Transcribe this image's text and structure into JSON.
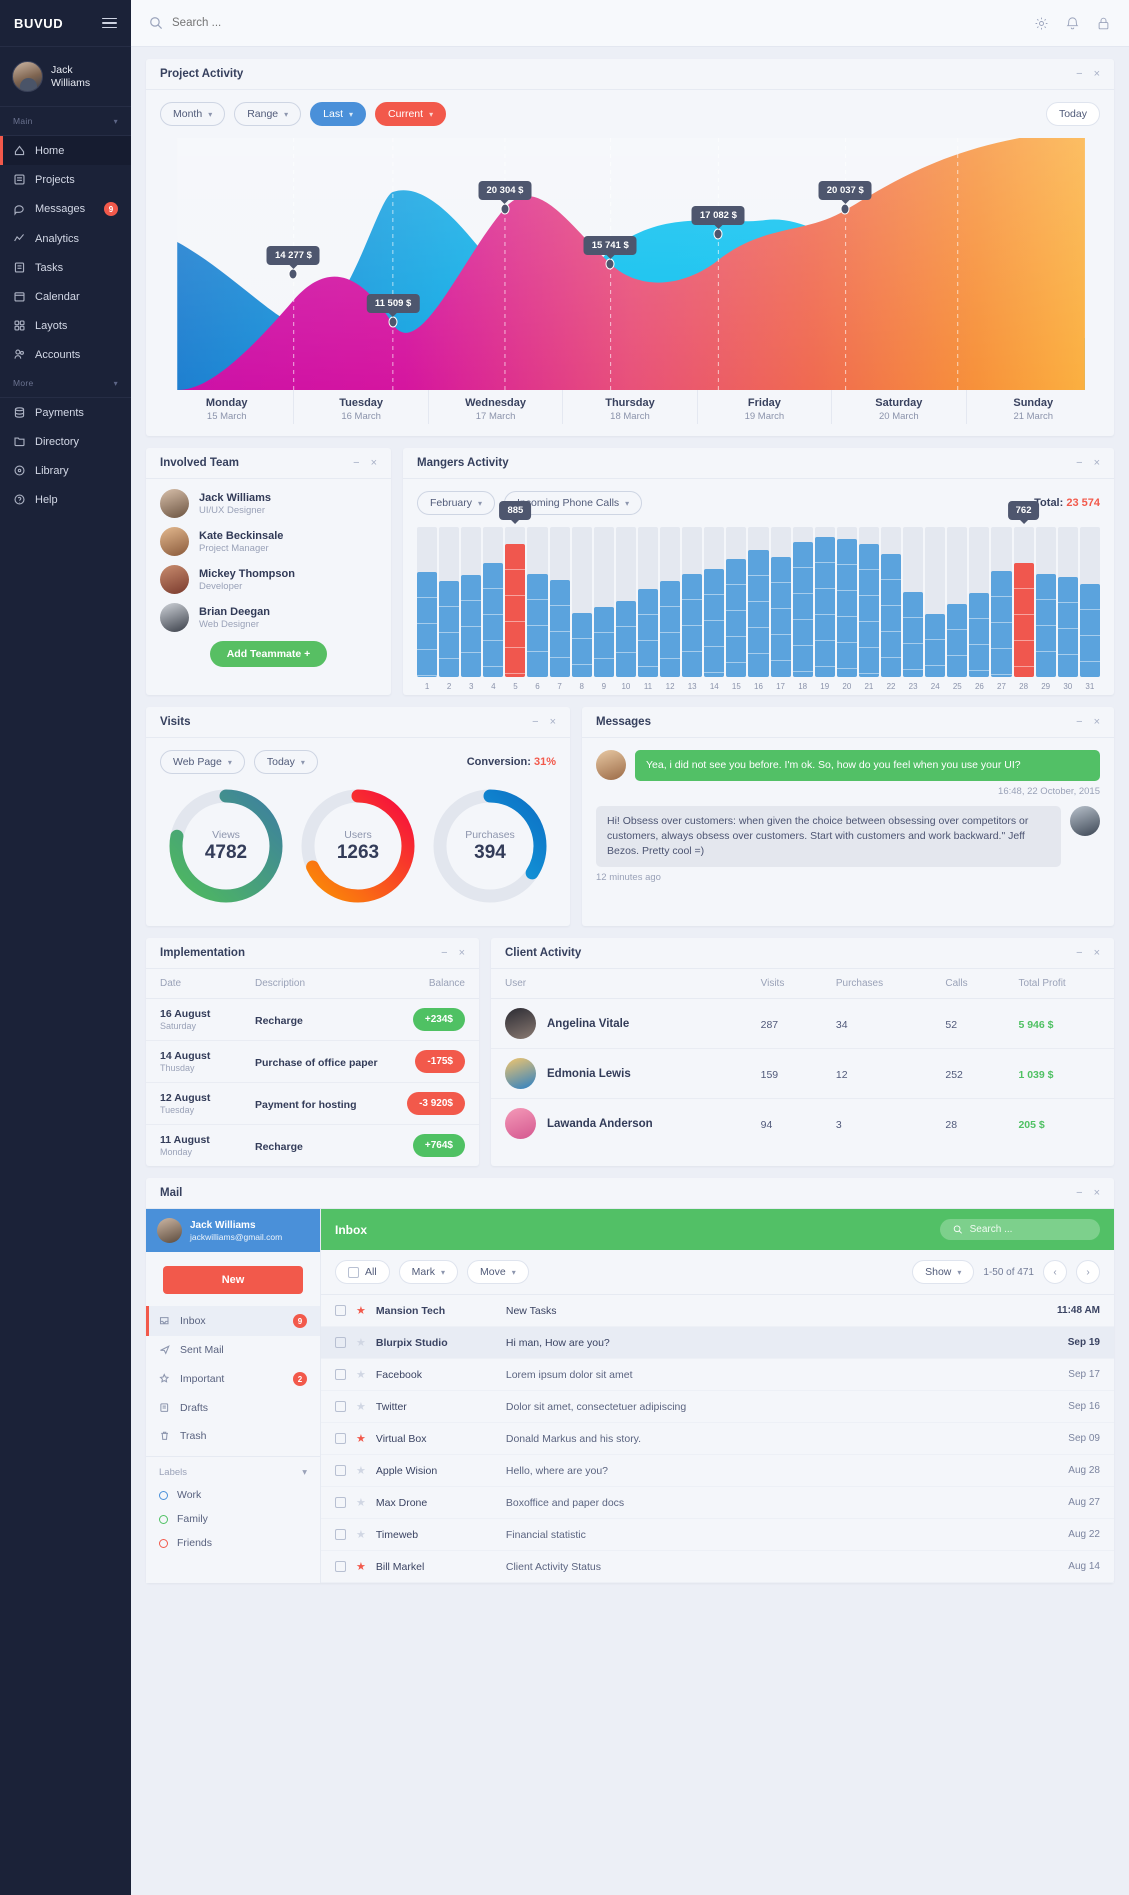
{
  "sidebar": {
    "logo": "BUVUD",
    "user": {
      "name": "Jack\nWilliams"
    },
    "groups": [
      {
        "label": "Main",
        "items": [
          {
            "label": "Home",
            "icon": "home-icon",
            "active": true
          },
          {
            "label": "Projects",
            "icon": "projects-icon"
          },
          {
            "label": "Messages",
            "icon": "messages-icon",
            "badge": "9"
          },
          {
            "label": "Analytics",
            "icon": "analytics-icon"
          },
          {
            "label": "Tasks",
            "icon": "tasks-icon"
          },
          {
            "label": "Calendar",
            "icon": "calendar-icon"
          },
          {
            "label": "Layots",
            "icon": "layouts-icon"
          },
          {
            "label": "Accounts",
            "icon": "accounts-icon"
          }
        ]
      },
      {
        "label": "More",
        "items": [
          {
            "label": "Payments",
            "icon": "payments-icon"
          },
          {
            "label": "Directory",
            "icon": "directory-icon"
          },
          {
            "label": "Library",
            "icon": "library-icon"
          },
          {
            "label": "Help",
            "icon": "help-icon"
          }
        ]
      }
    ]
  },
  "topbar": {
    "search_placeholder": "Search ...",
    "icons": [
      "gear-icon",
      "bell-icon",
      "lock-icon"
    ]
  },
  "project_activity": {
    "title": "Project Activity",
    "filters": [
      {
        "label": "Month",
        "style": "plain"
      },
      {
        "label": "Range",
        "style": "plain"
      },
      {
        "label": "Last",
        "style": "blue"
      },
      {
        "label": "Current",
        "style": "red"
      }
    ],
    "today_label": "Today"
  },
  "involved_team": {
    "title": "Involved Team",
    "members": [
      {
        "name": "Jack Williams",
        "role": "UI/UX Designer"
      },
      {
        "name": "Kate Beckinsale",
        "role": "Project Manager"
      },
      {
        "name": "Mickey Thompson",
        "role": "Developer"
      },
      {
        "name": "Brian Deegan",
        "role": "Web Designer"
      }
    ],
    "add_label": "Add Teammate  +"
  },
  "managers_activity": {
    "title": "Mangers Activity",
    "filters": [
      {
        "label": "February"
      },
      {
        "label": "Incoming Phone Calls"
      }
    ],
    "total_label": "Total:",
    "total_value": "23 574"
  },
  "visits": {
    "title": "Visits",
    "filters": [
      {
        "label": "Web Page"
      },
      {
        "label": "Today"
      }
    ],
    "conversion_label": "Conversion:",
    "conversion_value": "31%"
  },
  "messages": {
    "title": "Messages",
    "items": [
      {
        "text": "Yea, i did not see you before. I'm ok. So, how do you feel when you use your UI?",
        "time": "16:48, 22 October, 2015",
        "side": "left",
        "tone": "green"
      },
      {
        "text": "Hi! Obsess over customers: when given the choice between obsessing over competitors or customers, always obsess over customers. Start with customers and work backward.\" Jeff Bezos. Pretty cool =)",
        "time": "12 minutes ago",
        "side": "right",
        "tone": "grey"
      }
    ]
  },
  "implementation": {
    "title": "Implementation",
    "columns": [
      "Date",
      "Description",
      "Balance"
    ],
    "rows": [
      {
        "date": "16 August",
        "weekday": "Saturday",
        "desc": "Recharge",
        "balance": "+234$",
        "sign": "p"
      },
      {
        "date": "14 August",
        "weekday": "Thusday",
        "desc": "Purchase of office paper",
        "balance": "-175$",
        "sign": "n"
      },
      {
        "date": "12 August",
        "weekday": "Tuesday",
        "desc": "Payment for hosting",
        "balance": "-3 920$",
        "sign": "n"
      },
      {
        "date": "11 August",
        "weekday": "Monday",
        "desc": "Recharge",
        "balance": "+764$",
        "sign": "p"
      }
    ]
  },
  "client_activity": {
    "title": "Client Activity",
    "columns": [
      "User",
      "Visits",
      "Purchases",
      "Calls",
      "Total Profit"
    ],
    "rows": [
      {
        "name": "Angelina Vitale",
        "visits": "287",
        "purchases": "34",
        "calls": "52",
        "profit": "5 946 $"
      },
      {
        "name": "Edmonia Lewis",
        "visits": "159",
        "purchases": "12",
        "calls": "252",
        "profit": "1 039 $"
      },
      {
        "name": "Lawanda Anderson",
        "visits": "94",
        "purchases": "3",
        "calls": "28",
        "profit": "205 $"
      }
    ]
  },
  "mail": {
    "title": "Mail",
    "account": {
      "name": "Jack Williams",
      "email": "jackwilliams@gmail.com"
    },
    "new_label": "New",
    "folders": [
      {
        "label": "Inbox",
        "icon": "inbox-icon",
        "count": "9",
        "active": true
      },
      {
        "label": "Sent Mail",
        "icon": "sent-icon"
      },
      {
        "label": "Important",
        "icon": "star-icon",
        "count": "2"
      },
      {
        "label": "Drafts",
        "icon": "drafts-icon"
      },
      {
        "label": "Trash",
        "icon": "trash-icon"
      }
    ],
    "labels_title": "Labels",
    "labels": [
      {
        "label": "Work",
        "color": "#4a90d9"
      },
      {
        "label": "Family",
        "color": "#4fc163"
      },
      {
        "label": "Friends",
        "color": "#f2594b"
      }
    ],
    "inbox_title": "Inbox",
    "search_placeholder": "Search ...",
    "tools": [
      {
        "label": "All",
        "type": "check"
      },
      {
        "label": "Mark",
        "type": "dropdown"
      },
      {
        "label": "Move",
        "type": "dropdown"
      }
    ],
    "show_label": "Show",
    "page_info": "1-50 of 471",
    "rows": [
      {
        "from": "Mansion Tech",
        "subject": "New Tasks",
        "date": "11:48 AM",
        "star": true,
        "unread": true
      },
      {
        "from": "Blurpix Studio",
        "subject": "Hi man, How are you?",
        "date": "Sep 19",
        "star": false,
        "unread": true,
        "selected": true
      },
      {
        "from": "Facebook",
        "subject": "Lorem ipsum dolor sit amet",
        "date": "Sep 17",
        "star": false,
        "unread": false
      },
      {
        "from": "Twitter",
        "subject": "Dolor sit amet, consectetuer adipiscing",
        "date": "Sep 16",
        "star": false,
        "unread": false
      },
      {
        "from": "Virtual Box",
        "subject": "Donald Markus and his story.",
        "date": "Sep 09",
        "star": true,
        "unread": false
      },
      {
        "from": "Apple Wision",
        "subject": "Hello, where are you?",
        "date": "Aug 28",
        "star": false,
        "unread": false
      },
      {
        "from": "Max Drone",
        "subject": "Boxoffice and paper docs",
        "date": "Aug 27",
        "star": false,
        "unread": false
      },
      {
        "from": "Timeweb",
        "subject": "Financial statistic",
        "date": "Aug 22",
        "star": false,
        "unread": false
      },
      {
        "from": "Bill Markel",
        "subject": "Client Activity Status",
        "date": "Aug 14",
        "star": true,
        "unread": false
      }
    ]
  },
  "chart_data": [
    {
      "type": "area",
      "title": "Project Activity",
      "categories": [
        "Monday",
        "Tuesday",
        "Wednesday",
        "Thursday",
        "Friday",
        "Saturday",
        "Sunday"
      ],
      "tick_sublabels": [
        "15 March",
        "16 March",
        "17 March",
        "18 March",
        "19 March",
        "20 March",
        "21 March"
      ],
      "series": [
        {
          "name": "Current",
          "values": [
            14277,
            11509,
            20304,
            15741,
            17082,
            20037,
            22500
          ],
          "labels": [
            "14 277 $",
            "11 509 $",
            "20 304 $",
            "15 741 $",
            "17 082 $",
            "20 037 $",
            ""
          ]
        },
        {
          "name": "Last",
          "values": [
            15800,
            21500,
            19200,
            12800,
            11000,
            10200,
            9500
          ]
        }
      ],
      "ylabel": "",
      "xlabel": "",
      "grid": "vertical-dashed",
      "legend": "none"
    },
    {
      "type": "bar",
      "title": "Mangers Activity",
      "subtitle": "Incoming Phone Calls - February",
      "total": 23574,
      "categories": [
        "1",
        "2",
        "3",
        "4",
        "5",
        "6",
        "7",
        "8",
        "9",
        "10",
        "11",
        "12",
        "13",
        "14",
        "15",
        "16",
        "17",
        "18",
        "19",
        "20",
        "21",
        "22",
        "23",
        "24",
        "25",
        "26",
        "27",
        "28",
        "29",
        "30",
        "31"
      ],
      "values": [
        700,
        640,
        680,
        760,
        885,
        690,
        650,
        430,
        470,
        510,
        590,
        640,
        690,
        720,
        790,
        850,
        800,
        900,
        935,
        920,
        890,
        820,
        570,
        420,
        490,
        560,
        710,
        762,
        690,
        670,
        620
      ],
      "highlight_indexes": [
        4,
        27
      ],
      "highlight_labels": {
        "4": "885",
        "27": "762"
      },
      "ylim": [
        0,
        1000
      ],
      "grid": true,
      "legend": "none"
    },
    {
      "type": "pie",
      "title": "Visits",
      "subtitle": "Web Page - Today",
      "conversion": "31%",
      "donuts": [
        {
          "label": "Views",
          "value": 4782,
          "percent": 78,
          "color": "#4fbb5d"
        },
        {
          "label": "Users",
          "value": 1263,
          "percent": 68,
          "color": "#f6334f"
        },
        {
          "label": "Purchases",
          "value": 394,
          "percent": 34,
          "color": "#1e8fd5"
        }
      ]
    }
  ]
}
